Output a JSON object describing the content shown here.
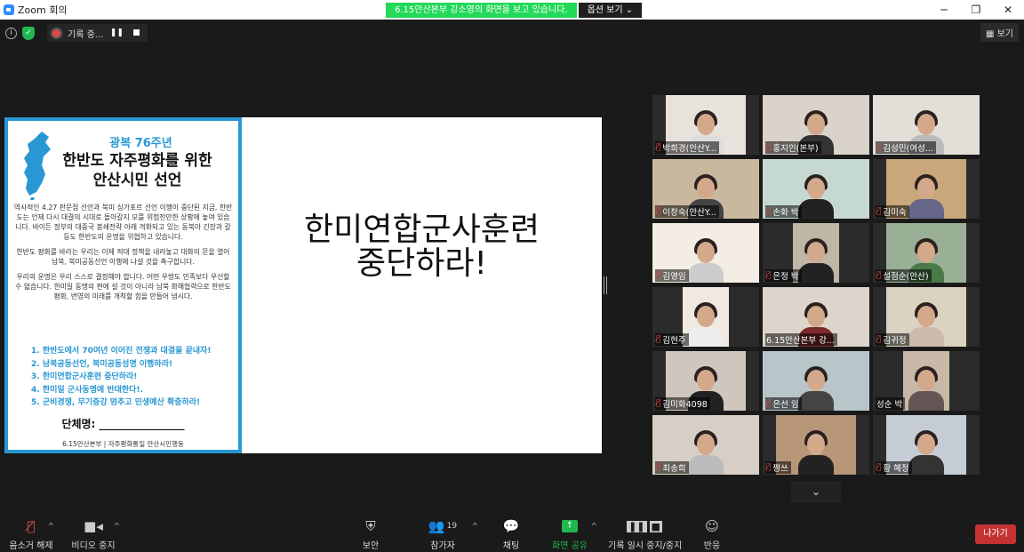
{
  "window": {
    "title": "Zoom 회의",
    "controls": [
      "─",
      "❐",
      "✕"
    ]
  },
  "share_banner": {
    "message": "6.15안산본부 강소영의 화면을 보고 있습니다.",
    "options": "옵션 보기 ⌄"
  },
  "recording": {
    "label": "기록 중..."
  },
  "view_button": {
    "label": "보기"
  },
  "poster": {
    "subtitle": "광복 76주년",
    "title_line1": "한반도 자주평화를 위한",
    "title_line2": "안산시민 선언",
    "paragraphs": [
      "역사적인 4.27 판문점 선언과 북미 싱가포르 선언 이행이 중단된 지금, 한반도는 언제 다시 대결의 시대로 돌아갈지 모를 위험천만한 상황에 놓여 있습니다. 바이든 정부의 대중국 봉쇄전략 아래 격화되고 있는 동북아 긴장과 갈등도 한반도의 운명을 위협하고 있습니다.",
      "한반도 평화를 바라는 우리는 이제 적대 정책을 내려놓고 대화의 문을 열어 남북, 북미공동선언 이행에 나설 것을 촉구합니다.",
      "우리의 운명은 우리 스스로 결정해야 합니다. 어떤 우방도 민족보다 우선할 수 없습니다. 한미일 동맹의 편에 설 것이 아니라 남북 화해협력으로 한반도 평화, 번영의 미래를 개척할 힘을 만들어 냅시다."
    ],
    "demands": [
      "1. 한반도에서 70여년 이어진 전쟁과 대결을 끝내자!",
      "2. 남북공동선언, 북미공동성명 이행하라!",
      "3. 한미연합군사훈련 중단하라!",
      "4. 한미일 군사동맹에 반대한다!.",
      "5. 군비경쟁, 무기증강 멈추고 민생예산 확충하라!"
    ],
    "sign": "단체명: ________________",
    "footer": "6.15안산본부  |  자주평화통일 안산시민행동"
  },
  "slogan": {
    "line1": "한미연합군사훈련",
    "line2": "중단하라!"
  },
  "participants": [
    {
      "name": "박희경(안산Y...",
      "muted": true
    },
    {
      "name": "홍지인(본부)",
      "muted": true
    },
    {
      "name": "김성민(여성...",
      "muted": true
    },
    {
      "name": "이창숙(안산Y...",
      "muted": true
    },
    {
      "name": "손화 박",
      "muted": true
    },
    {
      "name": "김미숙",
      "muted": true
    },
    {
      "name": "김영임",
      "muted": true
    },
    {
      "name": "은정 박",
      "muted": true
    },
    {
      "name": "설점순(안산)",
      "muted": true
    },
    {
      "name": "김현주",
      "muted": true
    },
    {
      "name": "6.15안산본부 강...",
      "muted": false
    },
    {
      "name": "김귀정",
      "muted": true
    },
    {
      "name": "김미화4098",
      "muted": true
    },
    {
      "name": "은선 임",
      "muted": true
    },
    {
      "name": "성순 박",
      "muted": false
    },
    {
      "name": "최송희",
      "muted": true
    },
    {
      "name": "짱쓰",
      "muted": true
    },
    {
      "name": "황 혜정",
      "muted": true
    }
  ],
  "toolbar": {
    "unmute": "음소거 해제",
    "video": "비디오 중지",
    "security": "보안",
    "participants": "참가자",
    "participants_count": "19",
    "chat": "채팅",
    "share": "화면 공유",
    "pause_record": "기록 일시 중지/중지",
    "reactions": "반응",
    "leave": "나가기"
  }
}
